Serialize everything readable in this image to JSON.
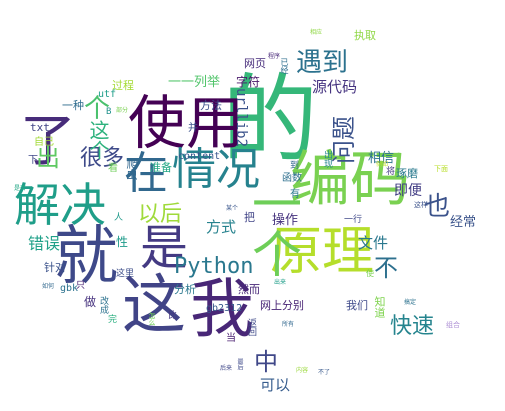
{
  "wordcloud": {
    "words": [
      {
        "text": "的",
        "color": "#35b779"
      },
      {
        "text": "使用",
        "color": "#440154"
      },
      {
        "text": "编码",
        "color": "#7ad151"
      },
      {
        "text": "就",
        "color": "#3e4989"
      },
      {
        "text": "我",
        "color": "#482777"
      },
      {
        "text": "这",
        "color": "#414487"
      },
      {
        "text": "情况",
        "color": "#26828e"
      },
      {
        "text": "在",
        "color": "#31688e"
      },
      {
        "text": "解决",
        "color": "#1f9e89"
      },
      {
        "text": "了",
        "color": "#472c7a"
      },
      {
        "text": "原理",
        "color": "#b5de2b"
      },
      {
        "text": "一个",
        "color": "#6ece58"
      },
      {
        "text": "是",
        "color": "#443a83"
      },
      {
        "text": "Python",
        "color": "#2a788e"
      },
      {
        "text": "问题",
        "color": "#3b528b"
      },
      {
        "text": "遇到",
        "color": "#2c728e"
      },
      {
        "text": "以后",
        "color": "#9fda3a"
      },
      {
        "text": "出",
        "color": "#5ec962"
      },
      {
        "text": "很多",
        "color": "#3e4a89"
      },
      {
        "text": "快速",
        "color": "#25848e"
      },
      {
        "text": "也",
        "color": "#3b528b"
      },
      {
        "text": "中",
        "color": "#3f4788"
      },
      {
        "text": "不",
        "color": "#2d708e"
      },
      {
        "text": "个",
        "color": "#4ac16d"
      },
      {
        "text": "这个",
        "color": "#2db27d"
      },
      {
        "text": "源代码",
        "color": "#463480"
      },
      {
        "text": "方式",
        "color": "#26828e"
      },
      {
        "text": "文件",
        "color": "#2a788e"
      },
      {
        "text": "错误",
        "color": "#1fa088"
      },
      {
        "text": "可以",
        "color": "#365c8d"
      },
      {
        "text": "操作",
        "color": "#46337e"
      },
      {
        "text": "即便",
        "color": "#433e85"
      },
      {
        "text": "经常",
        "color": "#3a538b"
      },
      {
        "text": "相信",
        "color": "#2c738e"
      },
      {
        "text": "urllib2",
        "color": "#3b528b"
      },
      {
        "text": "字符",
        "color": "#481769"
      },
      {
        "text": "网页",
        "color": "#472d7b"
      },
      {
        "text": "执取",
        "color": "#8fd744"
      },
      {
        "text": "一一列举",
        "color": "#50c46a"
      },
      {
        "text": "过程",
        "color": "#a5db36"
      },
      {
        "text": "方法",
        "color": "#3b528b"
      },
      {
        "text": "一种",
        "color": "#2f6c8e"
      },
      {
        "text": "utf",
        "color": "#1f9e89"
      },
      {
        "text": "txt",
        "color": "#414487"
      },
      {
        "text": "gbk",
        "color": "#2c728e"
      },
      {
        "text": "gb2312",
        "color": "#38598c"
      },
      {
        "text": "content",
        "color": "#39568c"
      },
      {
        "text": "准备",
        "color": "#22a785"
      },
      {
        "text": "函数",
        "color": "#2e6f8e"
      },
      {
        "text": "爬虫",
        "color": "#31678e"
      },
      {
        "text": "网上分别",
        "color": "#482475"
      },
      {
        "text": "我们",
        "color": "#3e4989"
      },
      {
        "text": "针对",
        "color": "#3b528b"
      },
      {
        "text": "分析",
        "color": "#2a778e"
      },
      {
        "text": "然而",
        "color": "#482878"
      },
      {
        "text": "把",
        "color": "#414487"
      },
      {
        "text": "一行",
        "color": "#3f4889"
      },
      {
        "text": "琢磨",
        "color": "#297a8e"
      },
      {
        "text": "知道",
        "color": "#7fd34e"
      },
      {
        "text": "做",
        "color": "#46327e"
      },
      {
        "text": "有",
        "color": "#2a788e"
      },
      {
        "text": "性",
        "color": "#1e9b8a"
      },
      {
        "text": "自己",
        "color": "#a2da37"
      },
      {
        "text": "下",
        "color": "#3f4889"
      },
      {
        "text": "看",
        "color": "#6ece58"
      },
      {
        "text": "改成",
        "color": "#2c728e"
      },
      {
        "text": "完",
        "color": "#29af7f"
      },
      {
        "text": "出现",
        "color": "#25858e"
      },
      {
        "text": "当",
        "color": "#481d6f"
      },
      {
        "text": "返回",
        "color": "#3e4a89"
      },
      {
        "text": "比",
        "color": "#453882"
      },
      {
        "text": "人",
        "color": "#1f9a8a"
      },
      {
        "text": "只",
        "color": "#482173"
      },
      {
        "text": "这里",
        "color": "#3d4e8a"
      },
      {
        "text": "将",
        "color": "#443983"
      },
      {
        "text": "到",
        "color": "#32658e"
      },
      {
        "text": "并",
        "color": "#3b528b"
      },
      {
        "text": "B",
        "color": "#21918c"
      },
      {
        "text": "已经",
        "color": "#2e6e8e"
      },
      {
        "text": "内容",
        "color": "#9bd93c"
      },
      {
        "text": "使",
        "color": "#7ad151"
      },
      {
        "text": "最后",
        "color": "#3e4989"
      },
      {
        "text": "出来",
        "color": "#1f9e89"
      },
      {
        "text": "下面",
        "color": "#b8de29"
      },
      {
        "text": "这样",
        "color": "#3b528b"
      },
      {
        "text": "例如",
        "color": "#bddf26"
      },
      {
        "text": "怎么",
        "color": "#70cf57"
      },
      {
        "text": "所有",
        "color": "#31688e"
      },
      {
        "text": "后来",
        "color": "#3f4788"
      },
      {
        "text": "不了",
        "color": "#38598c"
      },
      {
        "text": "如何",
        "color": "#31688e"
      },
      {
        "text": "搞定",
        "color": "#2c728e"
      },
      {
        "text": "是否",
        "color": "#22a884"
      },
      {
        "text": "部分",
        "color": "#7ad151"
      },
      {
        "text": "程序",
        "color": "#482878"
      },
      {
        "text": "某个",
        "color": "#39568c"
      },
      {
        "text": "相应",
        "color": "#8fd744"
      },
      {
        "text": "组合",
        "color": "#ad8fd4"
      }
    ]
  }
}
